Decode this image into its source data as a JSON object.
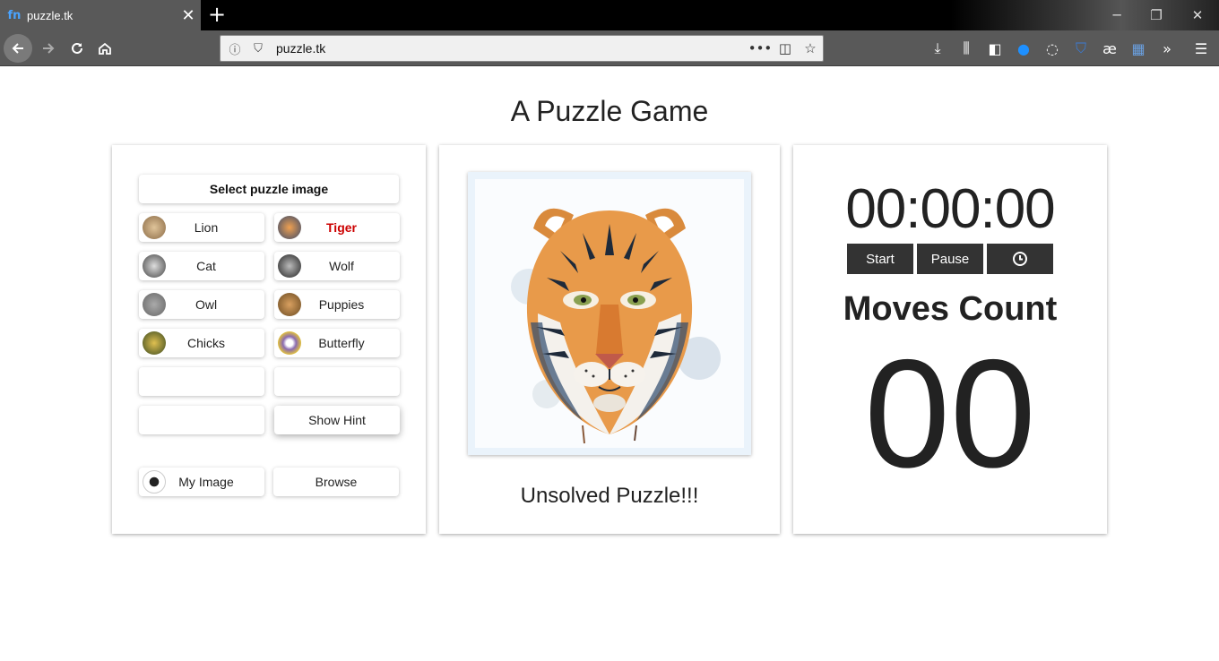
{
  "browser": {
    "tab_title": "puzzle.tk",
    "url": "puzzle.tk",
    "colors": {
      "chrome": "#595959",
      "titlebar": "#000000",
      "urlbar": "#f0f0f0"
    }
  },
  "page": {
    "title": "A Puzzle Game"
  },
  "selector": {
    "header": "Select puzzle image",
    "options": [
      {
        "label": "Lion",
        "active": false,
        "thumb_color": "#c9a57a"
      },
      {
        "label": "Tiger",
        "active": true,
        "thumb_color": "#d98a3c"
      },
      {
        "label": "Cat",
        "active": false,
        "thumb_color": "#9a9a9a"
      },
      {
        "label": "Wolf",
        "active": false,
        "thumb_color": "#4a4a4a"
      },
      {
        "label": "Owl",
        "active": false,
        "thumb_color": "#8a8a8a"
      },
      {
        "label": "Puppies",
        "active": false,
        "thumb_color": "#b07a3a"
      },
      {
        "label": "Chicks",
        "active": false,
        "thumb_color": "#7a6a3a"
      },
      {
        "label": "Butterfly",
        "active": false,
        "thumb_color": "#6a5a8a"
      }
    ],
    "hint_label": "Show Hint",
    "my_image_label": "My Image",
    "browse_label": "Browse",
    "active_color": "#cc0000"
  },
  "puzzle": {
    "image_alt": "tiger-watercolor-image",
    "status": "Unsolved Puzzle!!!"
  },
  "stats": {
    "timer": "00:00:00",
    "start_label": "Start",
    "pause_label": "Pause",
    "moves_label": "Moves Count",
    "moves_value": "00"
  }
}
